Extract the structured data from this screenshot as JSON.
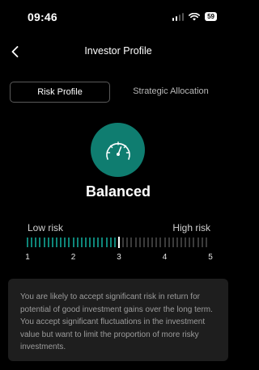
{
  "status_bar": {
    "time": "09:46",
    "battery": "59"
  },
  "nav": {
    "title": "Investor Profile",
    "back_icon": "chevron-left-icon"
  },
  "tabs": [
    {
      "label": "Risk Profile",
      "active": true
    },
    {
      "label": "Strategic Allocation",
      "active": false
    }
  ],
  "profile": {
    "name": "Balanced",
    "icon": "speedometer-icon",
    "icon_bg_color": "#0f7d70"
  },
  "risk_scale": {
    "low_label": "Low risk",
    "high_label": "High risk",
    "numbers": [
      "1",
      "2",
      "3",
      "4",
      "5"
    ],
    "min": 1,
    "max": 5,
    "value": 3,
    "active_color": "#12a898",
    "inactive_color": "#4a4a4a",
    "marker_color": "#ffffff"
  },
  "description": {
    "text": "You are likely to accept significant risk in return for potential of good investment gains over the long term. You accept significant fluctuations in the investment value but want to limit the proportion of more risky investments."
  }
}
